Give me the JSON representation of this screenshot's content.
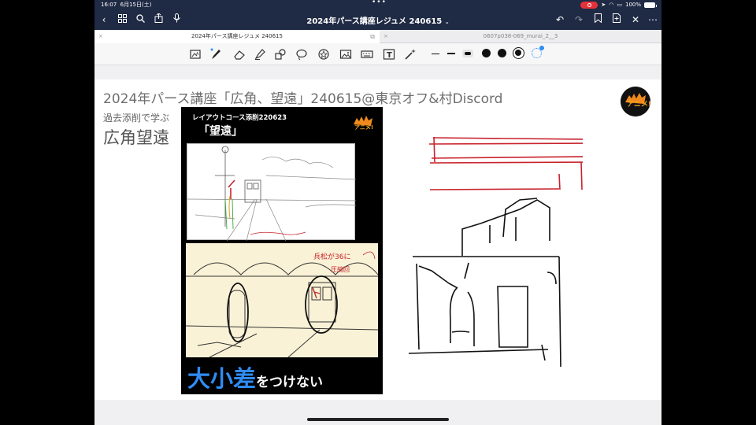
{
  "status_bar": {
    "time": "16:07",
    "date": "6月15日(土)",
    "battery": "100%",
    "colors": {
      "background": "#1f2a44",
      "record": "#e5323a"
    }
  },
  "nav_bar": {
    "title": "2024年パース講座レジュメ 240615",
    "left_icons": [
      "back-icon",
      "grid-icon",
      "search-icon",
      "share-icon",
      "mic-icon"
    ],
    "right_icons": [
      "undo-icon",
      "redo-icon",
      "bookmark-icon",
      "add-page-icon",
      "close-icon",
      "more-icon"
    ]
  },
  "tabs": [
    {
      "label": "2024年パース講座レジュメ 240615",
      "active": true
    },
    {
      "label": "0607p038-069_murai_2__3",
      "active": false
    }
  ],
  "toolbar": {
    "tools": [
      "lasso-scan-icon",
      "pen-icon",
      "eraser-icon",
      "highlighter-icon",
      "shapes-icon",
      "lasso-icon",
      "sticker-icon",
      "image-icon",
      "keyboard-icon",
      "text-icon",
      "laser-icon"
    ],
    "active_tool": "pen-icon",
    "stroke_widths": [
      "thin",
      "medium",
      "thick"
    ],
    "colors": [
      "#111111",
      "#111111",
      "#111111"
    ],
    "accent": "#2f8cf3"
  },
  "page": {
    "title": "2024年パース講座「広角、望遠」240615@東京オフ&村Discord",
    "subtitle": "過去添削で学ぶ",
    "label": "広角望遠",
    "logo_text": "アニメ!"
  },
  "slide": {
    "header": "レイアウトコース添削220623",
    "kanji": "「望遠」",
    "caption_big": "大小差",
    "caption_small": "をつけない",
    "annotation_1": "兵松が36に",
    "annotation_2": "圧縮回",
    "logo_text": "アニメ!",
    "caption_color": "#2f8cf3"
  }
}
